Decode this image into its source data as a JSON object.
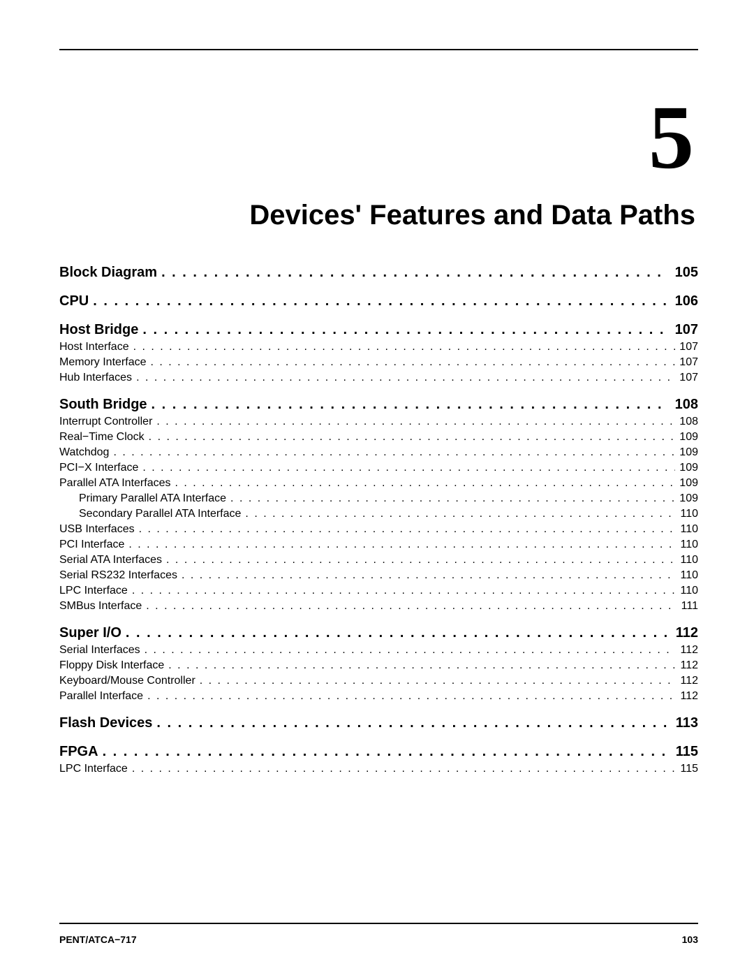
{
  "chapter_number": "5",
  "chapter_title": "Devices' Features and Data Paths",
  "toc": [
    {
      "level": 1,
      "label": "Block Diagram",
      "page": "105",
      "first": true
    },
    {
      "level": 1,
      "label": "CPU",
      "page": "106"
    },
    {
      "level": 1,
      "label": "Host Bridge",
      "page": "107"
    },
    {
      "level": 2,
      "label": "Host Interface",
      "page": "107"
    },
    {
      "level": 2,
      "label": "Memory Interface",
      "page": "107"
    },
    {
      "level": 2,
      "label": "Hub Interfaces",
      "page": "107"
    },
    {
      "level": 1,
      "label": "South Bridge",
      "page": "108"
    },
    {
      "level": 2,
      "label": "Interrupt Controller",
      "page": "108"
    },
    {
      "level": 2,
      "label": "Real−Time Clock",
      "page": "109"
    },
    {
      "level": 2,
      "label": "Watchdog",
      "page": "109"
    },
    {
      "level": 2,
      "label": "PCI−X Interface",
      "page": "109"
    },
    {
      "level": 2,
      "label": "Parallel ATA Interfaces",
      "page": "109"
    },
    {
      "level": 3,
      "label": "Primary Parallel ATA Interface",
      "page": "109"
    },
    {
      "level": 3,
      "label": "Secondary Parallel ATA Interface",
      "page": "110"
    },
    {
      "level": 2,
      "label": "USB Interfaces",
      "page": "110"
    },
    {
      "level": 2,
      "label": "PCI Interface",
      "page": "110"
    },
    {
      "level": 2,
      "label": "Serial ATA Interfaces",
      "page": "110"
    },
    {
      "level": 2,
      "label": "Serial RS232 Interfaces",
      "page": "110"
    },
    {
      "level": 2,
      "label": "LPC Interface",
      "page": "110"
    },
    {
      "level": 2,
      "label": "SMBus Interface",
      "page": "111"
    },
    {
      "level": 1,
      "label": "Super I/O",
      "page": "112"
    },
    {
      "level": 2,
      "label": "Serial Interfaces",
      "page": "112"
    },
    {
      "level": 2,
      "label": "Floppy Disk Interface",
      "page": "112"
    },
    {
      "level": 2,
      "label": "Keyboard/Mouse Controller",
      "page": "112"
    },
    {
      "level": 2,
      "label": "Parallel Interface",
      "page": "112"
    },
    {
      "level": 1,
      "label": "Flash Devices",
      "page": "113"
    },
    {
      "level": 1,
      "label": "FPGA",
      "page": "115"
    },
    {
      "level": 2,
      "label": "LPC Interface",
      "page": "115"
    }
  ],
  "footer": {
    "left": "PENT/ATCA−717",
    "right": "103"
  }
}
